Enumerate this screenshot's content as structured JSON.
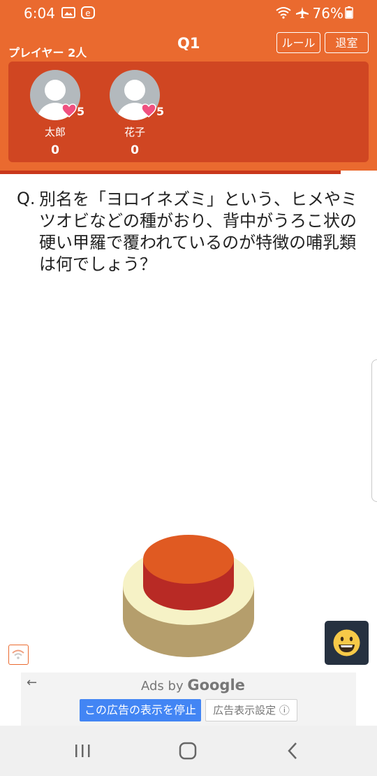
{
  "status_bar": {
    "time": "6:04",
    "battery": "76%",
    "icons": [
      "gallery-icon",
      "e-app-icon",
      "wifi-icon",
      "airplane-icon",
      "battery-charging-icon"
    ]
  },
  "header": {
    "players_label": "プレイヤー 2人",
    "question_number": "Q1",
    "rule_button": "ルール",
    "exit_button": "退室"
  },
  "players": [
    {
      "name": "太郎",
      "score": "0",
      "lives": "5"
    },
    {
      "name": "花子",
      "score": "0",
      "lives": "5"
    }
  ],
  "question": {
    "prefix": "Q.",
    "text": "別名を「ヨロイネズミ」という、ヒメやミツオビなどの種がおり、背中がうろこ状の硬い甲羅で覆われているのが特徴の哺乳類は何でしょう？"
  },
  "ad": {
    "back_icon": "←",
    "ads_by": "Ads by",
    "google": "Google",
    "stop_button": "この広告の表示を停止",
    "settings_button": "広告表示設定",
    "info_icon": "ⓘ"
  },
  "colors": {
    "header": "#ea6a2f",
    "panel": "#d04622",
    "buzzer_top": "#e05a22",
    "buzzer_side": "#b82a25",
    "buzzer_base_top": "#f6f2c6",
    "buzzer_base_side": "#b59e6c",
    "heart": "#f0507f",
    "emoji_bg": "#263140"
  }
}
